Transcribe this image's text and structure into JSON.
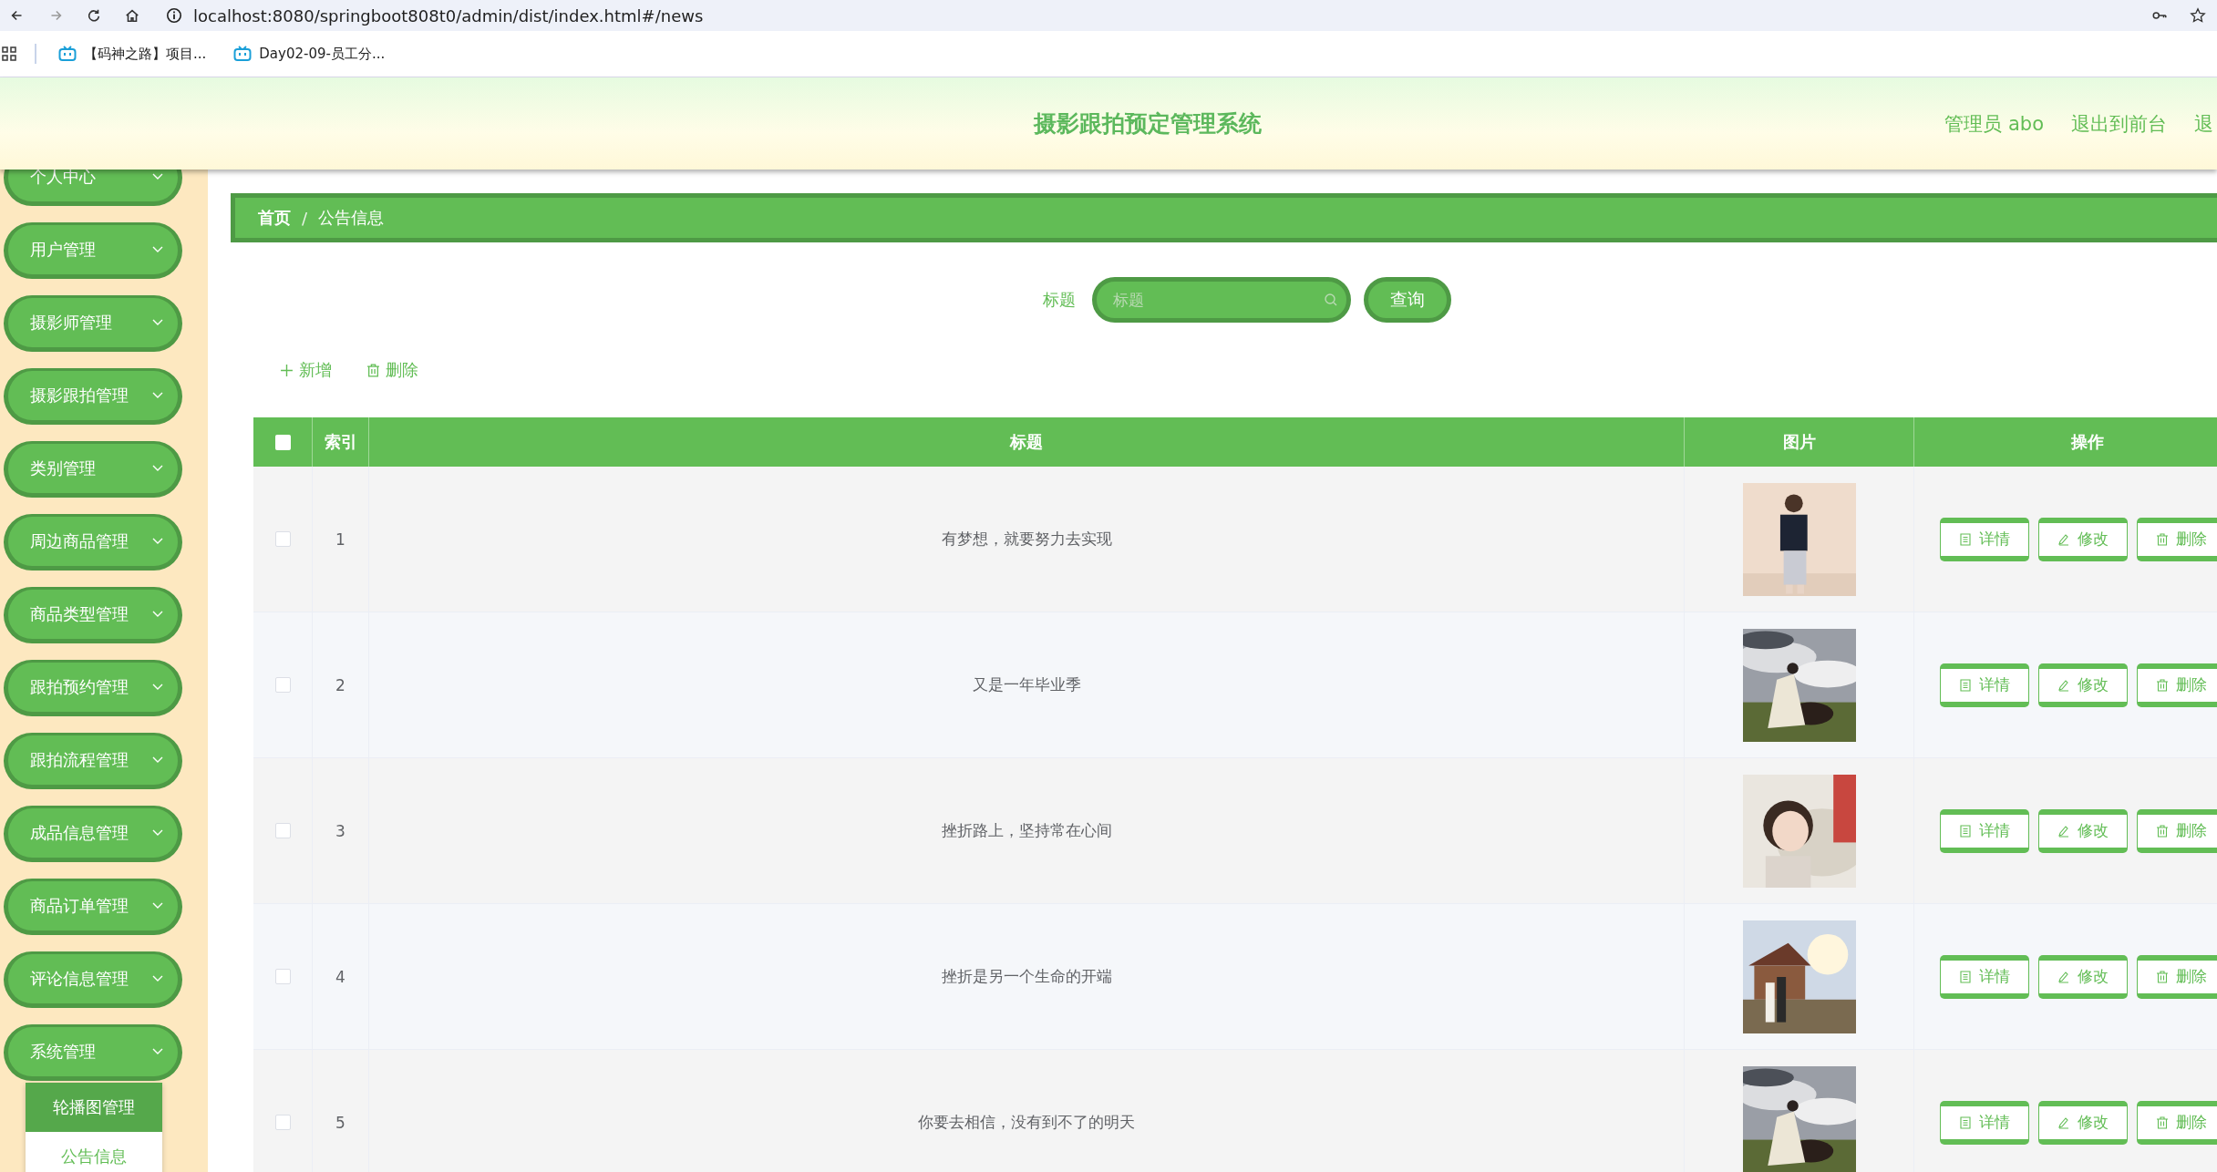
{
  "browser": {
    "url": "localhost:8080/springboot808t0/admin/dist/index.html#/news",
    "bookmarks": [
      "【码神之路】项目...",
      "Day02-09-员工分..."
    ]
  },
  "header": {
    "title": "摄影跟拍预定管理系统",
    "links": [
      "管理员 abo",
      "退出到前台",
      "退"
    ]
  },
  "sidebar": {
    "items": [
      {
        "label": "个人中心"
      },
      {
        "label": "用户管理"
      },
      {
        "label": "摄影师管理"
      },
      {
        "label": "摄影跟拍管理"
      },
      {
        "label": "类别管理"
      },
      {
        "label": "周边商品管理"
      },
      {
        "label": "商品类型管理"
      },
      {
        "label": "跟拍预约管理"
      },
      {
        "label": "跟拍流程管理"
      },
      {
        "label": "成品信息管理"
      },
      {
        "label": "商品订单管理"
      },
      {
        "label": "评论信息管理"
      },
      {
        "label": "系统管理",
        "children": [
          {
            "label": "轮播图管理",
            "selected": true
          },
          {
            "label": "公告信息",
            "selected": false
          }
        ]
      }
    ]
  },
  "breadcrumb": {
    "items": [
      "首页",
      "公告信息"
    ],
    "separator": "/"
  },
  "search": {
    "label": "标题",
    "placeholder": "标题",
    "button": "查询"
  },
  "actions": [
    {
      "kind": "add",
      "label": "新增"
    },
    {
      "kind": "delete",
      "label": "删除"
    }
  ],
  "table": {
    "header_checked": false,
    "columns": [
      "索引",
      "标题",
      "图片",
      "操作"
    ],
    "rows": [
      {
        "checked": false,
        "index": "1",
        "title": "有梦想，就要努力去实现",
        "picture": {
          "kind": "picture"
        },
        "operations": [
          {
            "kind": "detail",
            "label": "详情"
          },
          {
            "kind": "edit",
            "label": "修改"
          },
          {
            "kind": "delete",
            "label": "删除"
          }
        ]
      },
      {
        "checked": false,
        "index": "2",
        "title": "又是一年毕业季",
        "picture": {
          "kind": "picture"
        },
        "operations": [
          {
            "kind": "detail",
            "label": "详情"
          },
          {
            "kind": "edit",
            "label": "修改"
          },
          {
            "kind": "delete",
            "label": "删除"
          }
        ]
      },
      {
        "checked": false,
        "index": "3",
        "title": "挫折路上，坚持常在心间",
        "picture": {
          "kind": "picture"
        },
        "operations": [
          {
            "kind": "detail",
            "label": "详情"
          },
          {
            "kind": "edit",
            "label": "修改"
          },
          {
            "kind": "delete",
            "label": "删除"
          }
        ]
      },
      {
        "checked": false,
        "index": "4",
        "title": "挫折是另一个生命的开端",
        "picture": {
          "kind": "picture"
        },
        "operations": [
          {
            "kind": "detail",
            "label": "详情"
          },
          {
            "kind": "edit",
            "label": "修改"
          },
          {
            "kind": "delete",
            "label": "删除"
          }
        ]
      },
      {
        "checked": false,
        "index": "5",
        "title": "你要去相信，没有到不了的明天",
        "picture": {
          "kind": "picture"
        },
        "operations": [
          {
            "kind": "detail",
            "label": "详情"
          },
          {
            "kind": "edit",
            "label": "修改"
          },
          {
            "kind": "delete",
            "label": "删除"
          }
        ]
      }
    ]
  }
}
